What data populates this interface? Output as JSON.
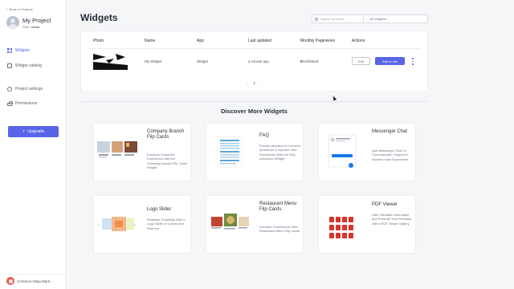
{
  "sidebar": {
    "back_label": "Back to Projects",
    "project_name": "My Project",
    "role_label": "Role:",
    "role_value": "owner",
    "nav": [
      {
        "label": "Widgets",
        "icon": "grid-icon",
        "active": true
      },
      {
        "label": "Widget catalog",
        "icon": "catalog-icon",
        "active": false
      },
      {
        "label": "Project settings",
        "icon": "gear-icon",
        "active": false
      },
      {
        "label": "Permissions",
        "icon": "lock-icon",
        "active": false
      }
    ],
    "upgrade_label": "Upgrade",
    "footer_label": "Common Ninja Mark..."
  },
  "header": {
    "title": "Widgets",
    "search_placeholder": "Search by name...",
    "filter_value": "-- All Widgets --"
  },
  "table": {
    "columns": [
      "Photo",
      "Name",
      "App",
      "Last updated",
      "Monthly Pageviews",
      "Actions"
    ],
    "rows": [
      {
        "name": "My Widget",
        "app": "Widget",
        "updated": "a minute ago",
        "views_count": "0",
        "views_limit": "/Unlimited"
      }
    ],
    "edit_label": "Edit",
    "add_label": "Add to site",
    "pager": {
      "prev": "‹",
      "page": "1",
      "next": "›"
    }
  },
  "discover": {
    "title": "Discover More Widgets",
    "cards": [
      {
        "title": "Company Branch Flip Cards",
        "description": "Enhance Customer Experience with the Company Branch Flip Cards Widget"
      },
      {
        "title": "FAQ",
        "description": "Provide Answers to Common Questions & Improve User Experience With the FAQ Accordion Widget"
      },
      {
        "title": "Messenger Chat",
        "description": "Use Messenger Chat To Communicate, Support & Improve User Experience"
      },
      {
        "title": "Logo Slider",
        "description": "Establish Credibility With a Logo Slider of Clients and Partners"
      },
      {
        "title": "Restaurant Menu Flip Cards",
        "description": "Increase Conversions With Restaurant Menu Flip Cards"
      },
      {
        "title": "PDF Viewer",
        "description": "Offer Valuable Information and Promote Your Products with a PDF Viewer Gallery"
      }
    ]
  },
  "colors": {
    "accent": "#5865e8",
    "background": "#f5f6f8",
    "brand_logo": "#f05a4f"
  }
}
